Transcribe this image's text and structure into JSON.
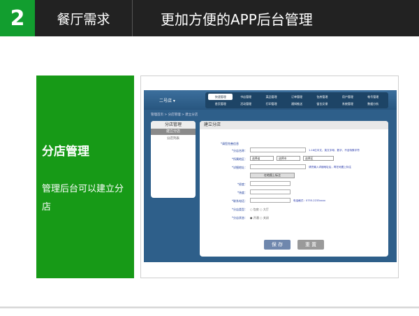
{
  "header": {
    "number": "2",
    "section": "餐厅需求",
    "title": "更加方便的APP后台管理"
  },
  "panel": {
    "heading": "分店管理",
    "desc": "管理后台可以建立分店"
  },
  "app": {
    "store_select": "二号店 ▾",
    "menus": [
      "快速管理",
      "书店管理",
      "菜品管理",
      "订单管理",
      "包房管理",
      "用户管理",
      "帐号管理",
      "首页管理",
      "活动管理",
      "打印管理",
      "通知推送",
      "留言反馈",
      "系统管理",
      "数据分析"
    ],
    "active_menu_index": 0,
    "breadcrumb": "管理首页 > 分店管理 > 建立分店",
    "sidebar": {
      "title": "分店管理",
      "active": "建立分店",
      "item": "分店列表"
    },
    "form": {
      "title": "建立分店",
      "note": "*请您完善信息",
      "name_label": "*分店名称：",
      "name_hint": "1-16位中文、英文字母、数字，不含特殊字符",
      "area_label": "*所属地区：",
      "province": "选择省",
      "city": "选择市",
      "district": "选择区",
      "address_label": "*详细地址：",
      "address_hint": "请先输入详细地址后，再在地图上标注",
      "map_button": "在地图上标注",
      "lng_label": "*经度：",
      "lat_label": "*纬度：",
      "phone_label": "*联系电话：",
      "phone_hint": "电话格式：0755-2233xxxx",
      "type_label": "*分店类型：",
      "type_opts": [
        "包房",
        "大厅"
      ],
      "status_label": "*分店状态：",
      "status_opts": [
        "开通",
        "关闭"
      ],
      "submit": "保 存",
      "reset": "重 置"
    }
  }
}
